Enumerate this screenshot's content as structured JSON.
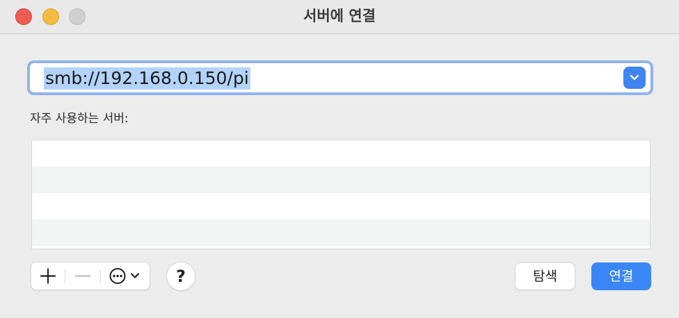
{
  "window": {
    "title": "서버에 연결"
  },
  "address": {
    "value": "smb://192.168.0.150/pi"
  },
  "favorites": {
    "label": "자주 사용하는 서버:",
    "items": []
  },
  "toolbar": {
    "add_icon": "plus-icon",
    "remove_icon": "minus-icon",
    "more_icon": "ellipsis-circle-icon",
    "help_label": "?"
  },
  "actions": {
    "browse_label": "탐색",
    "connect_label": "연결"
  },
  "colors": {
    "accent": "#3b86f7",
    "selection": "#b3d3fb",
    "close": "#ee5b52",
    "minimize": "#f4bc40"
  }
}
